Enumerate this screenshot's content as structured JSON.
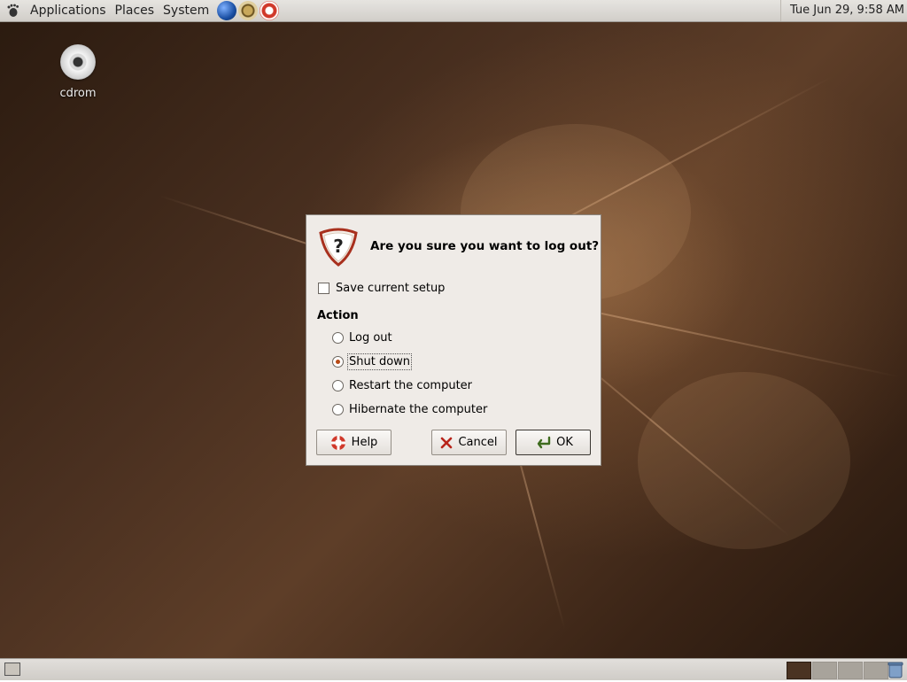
{
  "top_panel": {
    "menus": [
      "Applications",
      "Places",
      "System"
    ],
    "launchers": [
      "web-browser",
      "mail-client",
      "help"
    ],
    "clock": "Tue Jun 29,  9:58 AM"
  },
  "desktop": {
    "icons": [
      {
        "label": "cdrom",
        "icon": "cdrom-icon"
      }
    ]
  },
  "dialog": {
    "question": "Are you sure you want to log out?",
    "save_setup": {
      "label": "Save current setup",
      "checked": false
    },
    "action_heading": "Action",
    "options": [
      {
        "label": "Log out",
        "checked": false
      },
      {
        "label": "Shut down",
        "checked": true
      },
      {
        "label": "Restart the computer",
        "checked": false
      },
      {
        "label": "Hibernate the computer",
        "checked": false
      }
    ],
    "buttons": {
      "help": "Help",
      "cancel": "Cancel",
      "ok": "OK"
    }
  },
  "bottom_panel": {
    "workspaces": 4,
    "active_workspace": 1
  },
  "colors": {
    "desktop_accent": "#5e3e28",
    "dialog_bg": "#efebe7",
    "radio_accent": "#b84a16"
  }
}
